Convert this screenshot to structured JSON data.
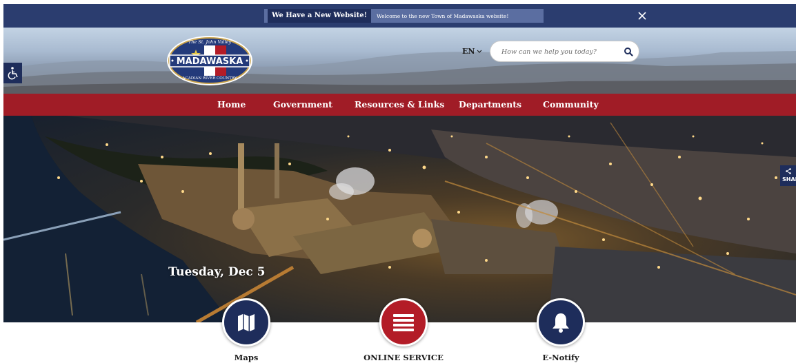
{
  "alert": {
    "title": "We Have a New Website!",
    "message": "Welcome to the new Town of Madawaska website!",
    "close_icon": "close-icon"
  },
  "logo": {
    "top_text": "The St. John Valley",
    "name": "MADAWASKA",
    "bottom_text": "ACADIAN RIVER COUNTRY"
  },
  "header": {
    "language": "EN",
    "search_placeholder": "How can we help you today?"
  },
  "nav": {
    "items": [
      {
        "label": "Home"
      },
      {
        "label": "Government"
      },
      {
        "label": "Resources & Links"
      },
      {
        "label": "Departments"
      },
      {
        "label": "Community"
      }
    ]
  },
  "hero": {
    "date": "Tuesday, Dec 5",
    "share_label": "SHARE"
  },
  "quick_links": [
    {
      "label": "Maps",
      "icon": "map-icon",
      "color": "#1e2d5b"
    },
    {
      "label": "ONLINE SERVICE",
      "icon": "list-icon",
      "color": "#b31c27"
    },
    {
      "label": "E-Notify",
      "icon": "bell-icon",
      "color": "#1e2d5b"
    }
  ],
  "colors": {
    "navy": "#2b3d6f",
    "dark_navy": "#1e2d5b",
    "red": "#a01c26"
  }
}
